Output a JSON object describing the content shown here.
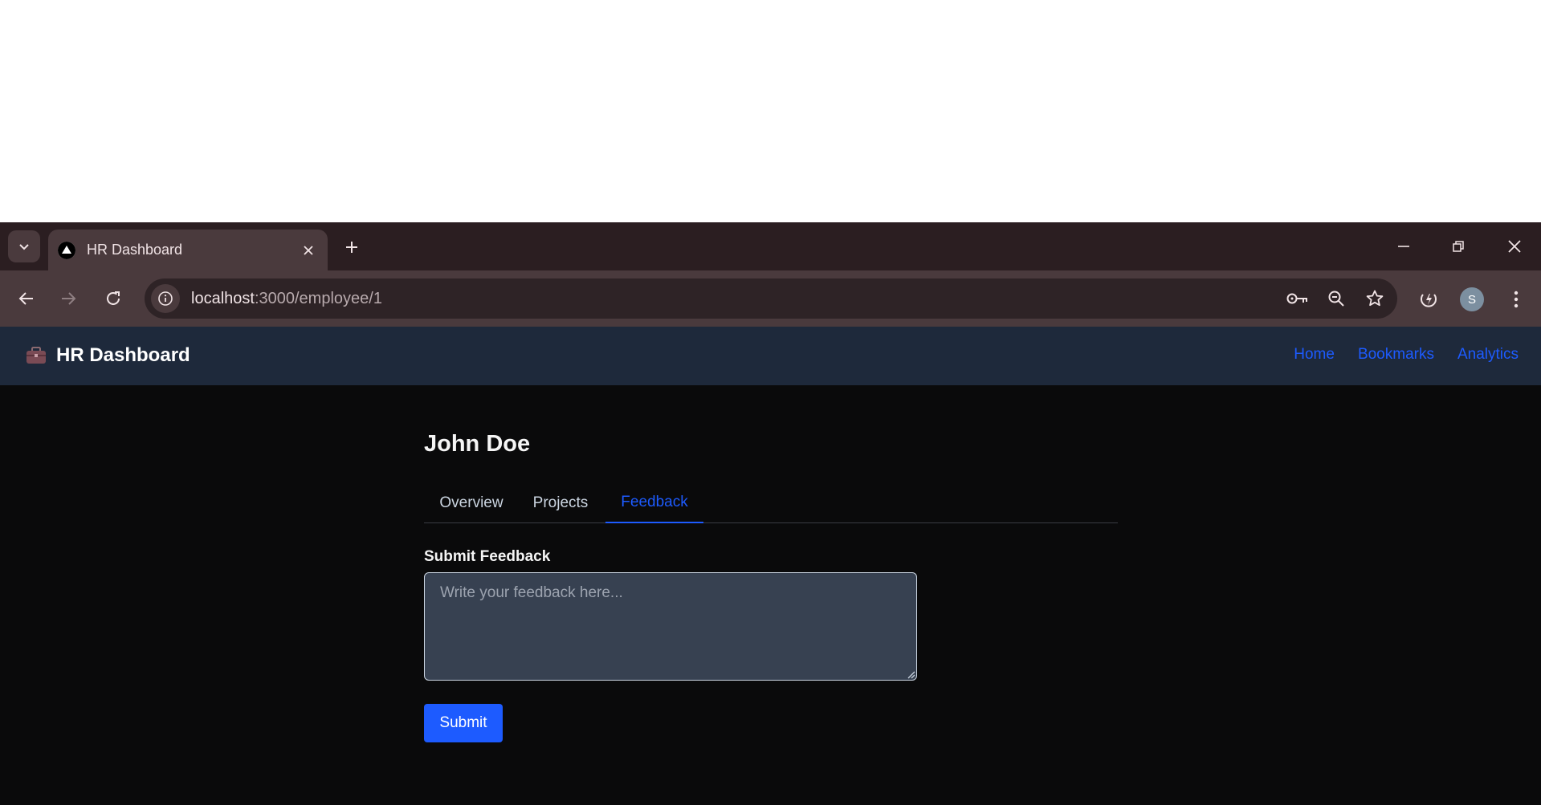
{
  "browser": {
    "tab_title": "HR Dashboard",
    "url_host": "localhost",
    "url_rest": ":3000/employee/1",
    "profile_initial": "S"
  },
  "navbar": {
    "brand_text": "HR Dashboard",
    "links": [
      "Home",
      "Bookmarks",
      "Analytics"
    ]
  },
  "employee": {
    "name": "John Doe"
  },
  "tabs": [
    "Overview",
    "Projects",
    "Feedback"
  ],
  "active_tab": "Feedback",
  "feedback": {
    "section_label": "Submit Feedback",
    "placeholder": "Write your feedback here...",
    "value": "",
    "submit_label": "Submit"
  },
  "colors": {
    "accent": "#1d5bff",
    "navbar_bg": "#1e293b",
    "page_bg": "#0a0a0b",
    "input_bg": "#374151",
    "chrome_bg": "#2b1e21"
  }
}
